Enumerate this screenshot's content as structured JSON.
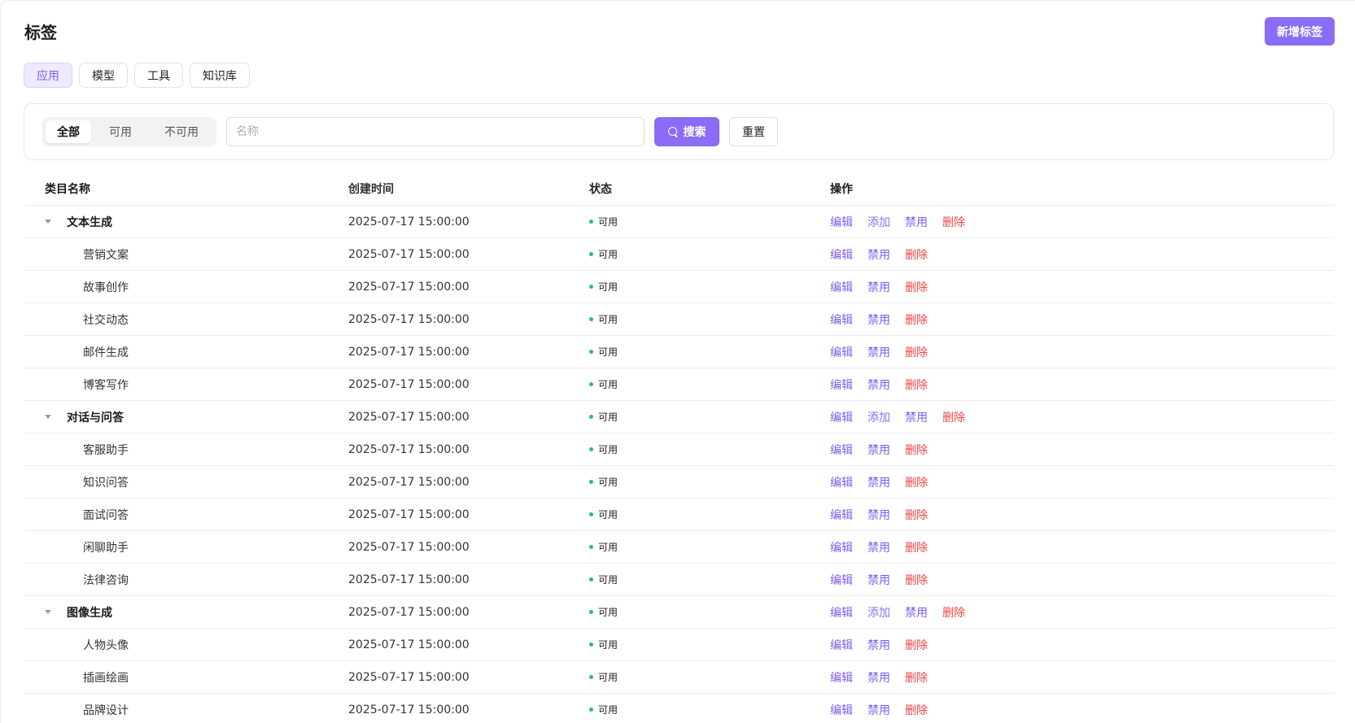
{
  "header": {
    "title": "标签",
    "add_label": "新增标签"
  },
  "categories": [
    "应用",
    "模型",
    "工具",
    "知识库"
  ],
  "filter": {
    "status_options": [
      "全部",
      "可用",
      "不可用"
    ],
    "name_placeholder": "名称",
    "search_label": "搜索",
    "reset_label": "重置"
  },
  "table": {
    "columns": [
      "类目名称",
      "创建时间",
      "状态",
      "操作"
    ],
    "actions": {
      "edit": "编辑",
      "add": "添加",
      "disable": "禁用",
      "delete": "删除"
    },
    "rows": [
      {
        "name": "文本生成",
        "time": "2025-07-17 15:00:00",
        "status": "可用"
      },
      {
        "name": "营销文案",
        "time": "2025-07-17 15:00:00",
        "status": "可用"
      },
      {
        "name": "故事创作",
        "time": "2025-07-17 15:00:00",
        "status": "可用"
      },
      {
        "name": "社交动态",
        "time": "2025-07-17 15:00:00",
        "status": "可用"
      },
      {
        "name": "邮件生成",
        "time": "2025-07-17 15:00:00",
        "status": "可用"
      },
      {
        "name": "博客写作",
        "time": "2025-07-17 15:00:00",
        "status": "可用"
      },
      {
        "name": "对话与问答",
        "time": "2025-07-17 15:00:00",
        "status": "可用"
      },
      {
        "name": "客服助手",
        "time": "2025-07-17 15:00:00",
        "status": "可用"
      },
      {
        "name": "知识问答",
        "time": "2025-07-17 15:00:00",
        "status": "可用"
      },
      {
        "name": "面试问答",
        "time": "2025-07-17 15:00:00",
        "status": "可用"
      },
      {
        "name": "闲聊助手",
        "time": "2025-07-17 15:00:00",
        "status": "可用"
      },
      {
        "name": "法律咨询",
        "time": "2025-07-17 15:00:00",
        "status": "可用"
      },
      {
        "name": "图像生成",
        "time": "2025-07-17 15:00:00",
        "status": "可用"
      },
      {
        "name": "人物头像",
        "time": "2025-07-17 15:00:00",
        "status": "可用"
      },
      {
        "name": "插画绘画",
        "time": "2025-07-17 15:00:00",
        "status": "可用"
      },
      {
        "name": "品牌设计",
        "time": "2025-07-17 15:00:00",
        "status": "可用"
      }
    ]
  },
  "colors": {
    "accent": "#8b6cf6",
    "danger": "#ef4444",
    "status_ok": "#22c55e"
  }
}
